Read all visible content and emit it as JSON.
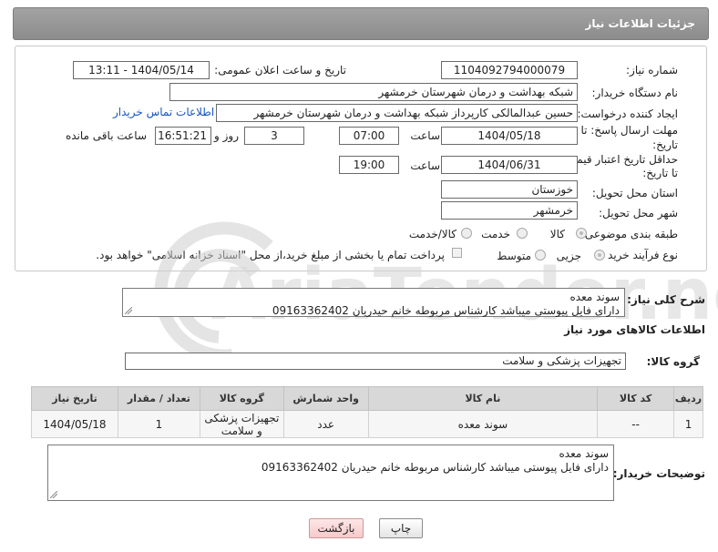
{
  "header": {
    "title": "جزئیات اطلاعات نیاز"
  },
  "form": {
    "need_number_label": "شماره نیاز:",
    "need_number": "1104092794000079",
    "announce_label": "تاریخ و ساعت اعلان عمومی:",
    "announce_value": "1404/05/14 - 13:11",
    "buyer_org_label": "نام دستگاه خریدار:",
    "buyer_org": "شبکه بهداشت و درمان شهرستان خرمشهر",
    "creator_label": "ایجاد کننده درخواست:",
    "creator": "حسین عبدالمالکی کارپرداز شبکه بهداشت و درمان شهرستان خرمشهر",
    "contact_link": "اطلاعات تماس خریدار",
    "deadline_label_1": "مهلت ارسال پاسخ: تا",
    "deadline_label_2": "تاریخ:",
    "deadline_date": "1404/05/18",
    "hour_label": "ساعت",
    "deadline_time": "07:00",
    "days_value": "3",
    "days_label": "روز و",
    "remaining_time": "16:51:21",
    "remaining_label": "ساعت باقی مانده",
    "price_label_1": "حداقل تاریخ اعتبار قیمت:",
    "price_label_2": "تا تاریخ:",
    "price_date": "1404/06/31",
    "price_time": "19:00",
    "province_label": "استان محل تحویل:",
    "province": "خوزستان",
    "city_label": "شهر محل تحویل:",
    "city": "خرمشهر",
    "category_label": "طبقه بندی موضوعی:",
    "category_options": [
      "کالا",
      "خدمت",
      "کالا/خدمت"
    ],
    "process_label": "نوع فرآیند خرید :",
    "process_options": [
      "جزیی",
      "متوسط"
    ],
    "payment_note": "پرداخت تمام یا بخشی از مبلغ خرید،از محل \"اسناد خزانه اسلامی\" خواهد بود."
  },
  "summary": {
    "label": "شرح کلی نیاز:",
    "line1": "سوند معده",
    "line2": "دارای فایل پیوستی میباشد کارشناس مربوطه خانم حیدریان 09163362402"
  },
  "goods_section": {
    "title": "اطلاعات کالاهای مورد نیاز",
    "group_label": "گروه کالا:",
    "group_value": "تجهیزات پزشکی و سلامت"
  },
  "table": {
    "headers": [
      "ردیف",
      "کد کالا",
      "نام کالا",
      "واحد شمارش",
      "گروه کالا",
      "تعداد / مقدار",
      "تاریخ نیاز"
    ],
    "rows": [
      [
        "1",
        "--",
        "سوند معده",
        "عدد",
        "تجهیزات پزشکی و سلامت",
        "1",
        "1404/05/18"
      ]
    ]
  },
  "buyer_notes": {
    "label": "توضیحات خریدار:",
    "line1": "سوند معده",
    "line2": "دارای فایل پیوستی میباشد کارشناس مربوطه خانم حیدریان 09163362402"
  },
  "buttons": {
    "print": "چاپ",
    "back": "بازگشت"
  },
  "watermark": {
    "text": "AriaTender.neT"
  },
  "colors": {
    "header_bg": "#999999",
    "link": "#1a56c0",
    "back_button": "#f6caca"
  }
}
